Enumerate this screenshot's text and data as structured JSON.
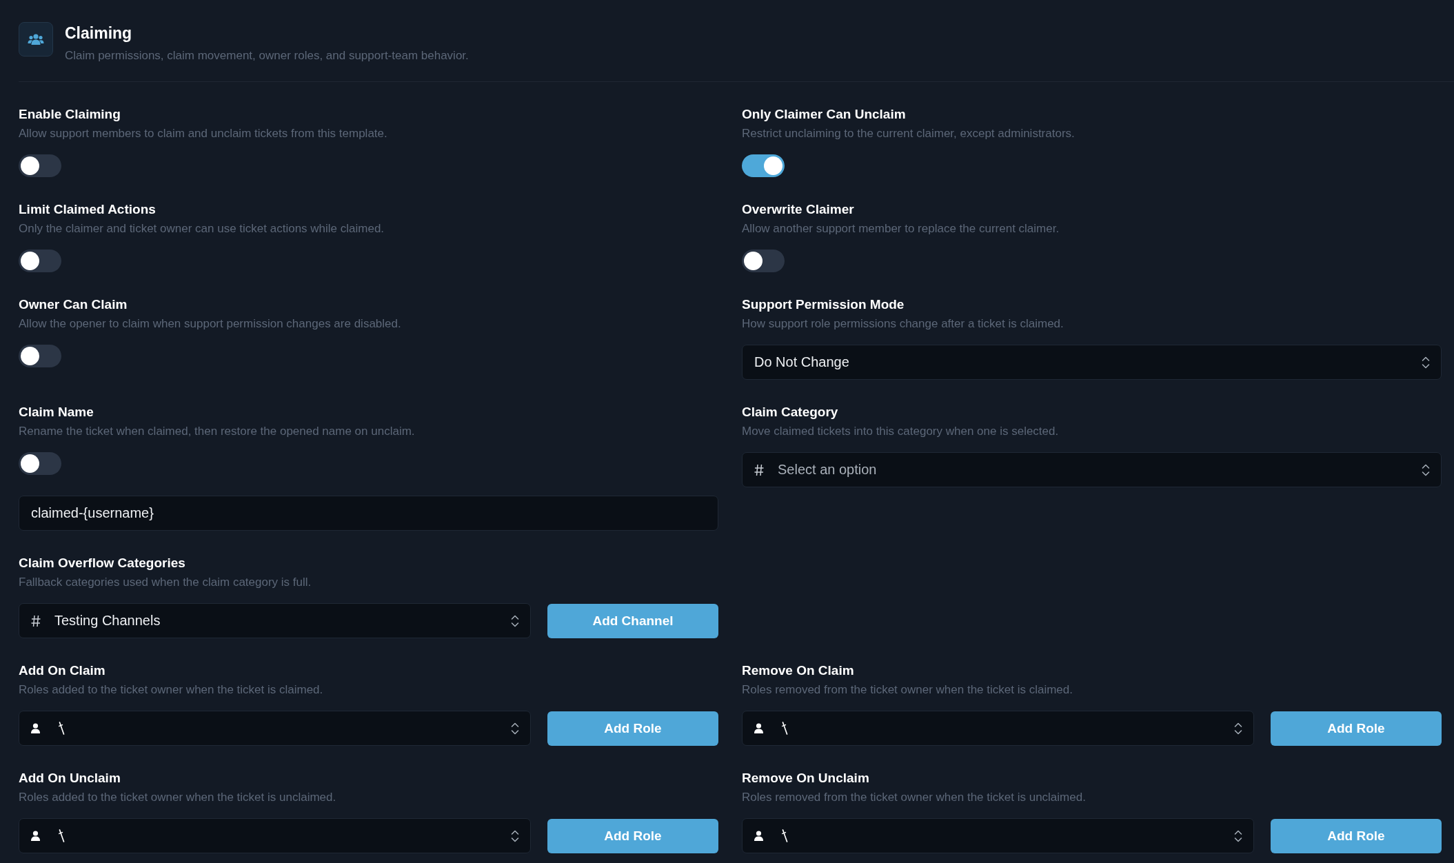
{
  "header": {
    "title": "Claiming",
    "subtitle": "Claim permissions, claim movement, owner roles, and support-team behavior."
  },
  "rows": [
    {
      "items": [
        {
          "kind": "toggle",
          "label": "Enable Claiming",
          "description": "Allow support members to claim and unclaim tickets from this template.",
          "toggle": {
            "on": false
          }
        },
        {
          "kind": "toggle",
          "label": "Only Claimer Can Unclaim",
          "description": "Restrict unclaiming to the current claimer, except administrators.",
          "toggle": {
            "on": true
          }
        }
      ]
    },
    {
      "items": [
        {
          "kind": "toggle",
          "label": "Limit Claimed Actions",
          "description": "Only the claimer and ticket owner can use ticket actions while claimed.",
          "toggle": {
            "on": false
          }
        },
        {
          "kind": "toggle",
          "label": "Overwrite Claimer",
          "description": "Allow another support member to replace the current claimer.",
          "toggle": {
            "on": false
          }
        }
      ]
    },
    {
      "items": [
        {
          "kind": "toggle",
          "label": "Owner Can Claim",
          "description": "Allow the opener to claim when support permission changes are disabled.",
          "toggle": {
            "on": false
          }
        },
        {
          "kind": "select",
          "label": "Support Permission Mode",
          "description": "How support role permissions change after a ticket is claimed.",
          "select": {
            "kind": "plain",
            "value": "Do Not Change"
          }
        }
      ]
    },
    {
      "items": [
        {
          "kind": "toggle_input",
          "label": "Claim Name",
          "description": "Rename the ticket when claimed, then restore the opened name on unclaim.",
          "toggle": {
            "on": false
          },
          "input": {
            "value": "claimed-{username}"
          }
        },
        {
          "kind": "select",
          "label": "Claim Category",
          "description": "Move claimed tickets into this category when one is selected.",
          "select": {
            "kind": "channel",
            "placeholder": "Select an option"
          }
        }
      ]
    },
    {
      "items": [
        {
          "kind": "select_button",
          "label": "Claim Overflow Categories",
          "description": "Fallback categories used when the claim category is full.",
          "select": {
            "kind": "channel",
            "value": "Testing Channels"
          },
          "button": "Add Channel"
        }
      ]
    },
    {
      "items": [
        {
          "kind": "select_button",
          "label": "Add On Claim",
          "description": "Roles added to the ticket owner when the ticket is claimed.",
          "select": {
            "kind": "role"
          },
          "button": "Add Role"
        },
        {
          "kind": "select_button",
          "label": "Remove On Claim",
          "description": "Roles removed from the ticket owner when the ticket is claimed.",
          "select": {
            "kind": "role"
          },
          "button": "Add Role"
        }
      ]
    },
    {
      "items": [
        {
          "kind": "select_button",
          "label": "Add On Unclaim",
          "description": "Roles added to the ticket owner when the ticket is unclaimed.",
          "select": {
            "kind": "role"
          },
          "button": "Add Role"
        },
        {
          "kind": "select_button",
          "label": "Remove On Unclaim",
          "description": "Roles removed from the ticket owner when the ticket is unclaimed.",
          "select": {
            "kind": "role"
          },
          "button": "Add Role"
        }
      ]
    }
  ]
}
